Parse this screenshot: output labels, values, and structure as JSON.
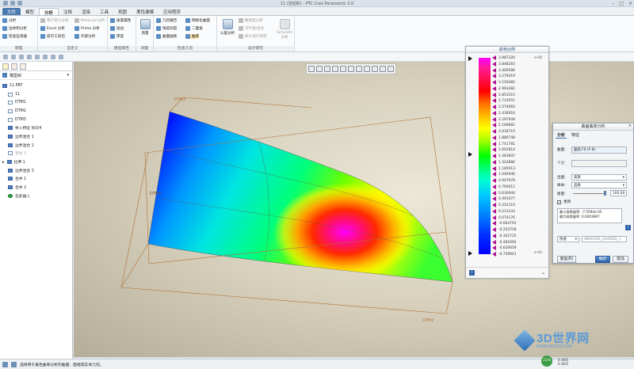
{
  "app": {
    "title": "11 (活动的) - PTC Creo Parametric 3.0"
  },
  "menu": {
    "tabs": [
      "文件",
      "模型",
      "分析",
      "注释",
      "渲染",
      "工具",
      "视图",
      "柔性建模",
      "应用程序"
    ]
  },
  "ribbon": {
    "items_col1": [
      "分析",
      "边体积分析",
      "检查监测器"
    ],
    "items_col2": [
      "用户定义分析",
      "Excel 分析",
      "提示工具包"
    ],
    "items_col3": [
      "Mathcad 分析",
      "Prime 分析",
      "外部分析"
    ],
    "items_model": [
      "质量属性",
      "短边",
      "厚度"
    ],
    "measure": "测量",
    "items_check1": [
      "几何报告",
      "快提斜度",
      "曲面曲率"
    ],
    "items_check2": [
      "网格化曲面",
      "二面角",
      "曲率"
    ],
    "shape": "公差分析",
    "items_design": [
      "敏感度分析",
      "可行性/优化",
      "统计设计研究"
    ],
    "simulate": "Simulate 分析",
    "group_labels": [
      "管理",
      "自定义",
      "模型报告",
      "测量",
      "检查几何",
      "设计研究"
    ]
  },
  "tree": {
    "header": "模型树",
    "items": [
      "11.PRT",
      "11",
      "DTM1",
      "DTM2",
      "DTM3",
      "导入特征 标识4",
      "边界混合 1",
      "边界混合 2",
      "草绘 1",
      "拉伸 1",
      "边界混合 3",
      "合并 1",
      "合并 2",
      "在此插入"
    ]
  },
  "viewport": {
    "datums": [
      "DTM3",
      "DTM1",
      "DTM2"
    ]
  },
  "color_scale": {
    "title": "颜色比例",
    "unit": "e-04",
    "values": [
      "3.987320",
      "3.848283",
      "3.409586",
      "3.279419",
      "3.150482",
      "2.993482",
      "2.853515",
      "2.714551",
      "2.574683",
      "2.436616",
      "2.297649",
      "2.168682",
      "2.018715",
      "1.880748",
      "1.741781",
      "1.602814",
      "1.463847",
      "1.324880",
      "1.185913",
      "1.046946",
      "0.907978",
      "0.769011",
      "0.630044",
      "0.491077",
      "0.352110",
      "0.213143",
      "0.074176",
      "-0.064791",
      "-0.203758",
      "-0.342725",
      "-0.481692",
      "-0.620659",
      "-0.759941"
    ]
  },
  "dialog": {
    "title": "曲面曲率分析",
    "tabs": [
      "分析",
      "特征"
    ],
    "surface_label": "曲面:",
    "surface_value": "面组 F6 (F-8)",
    "plane_label": "平面:",
    "out_label": "出图:",
    "out_value": "高斯",
    "sample_label": "样本:",
    "sample_value": "品质",
    "quality_label": "质量:",
    "quality_value": "100.00",
    "update_label": "更新",
    "results": [
      "最小高斯曲率: -7.5594e-05",
      "最大高斯曲率: 0.0003987"
    ],
    "mode": "快速",
    "name": "ANALYSIS_SHADED_1",
    "buttons": [
      "重复(R)",
      "确定",
      "取消"
    ]
  },
  "status": {
    "message": "选择用于着色曲率分析的曲面、面组或实体几何。"
  },
  "tray": {
    "badge": "21%",
    "net_up": "0.1K/S",
    "net_down": "0.1K/S"
  },
  "watermark": {
    "title": "3D世界网",
    "url": "WWW.3DSJW.COM"
  },
  "colors": {
    "accent": "#4a7ab0",
    "ok": "#2d61a6"
  }
}
